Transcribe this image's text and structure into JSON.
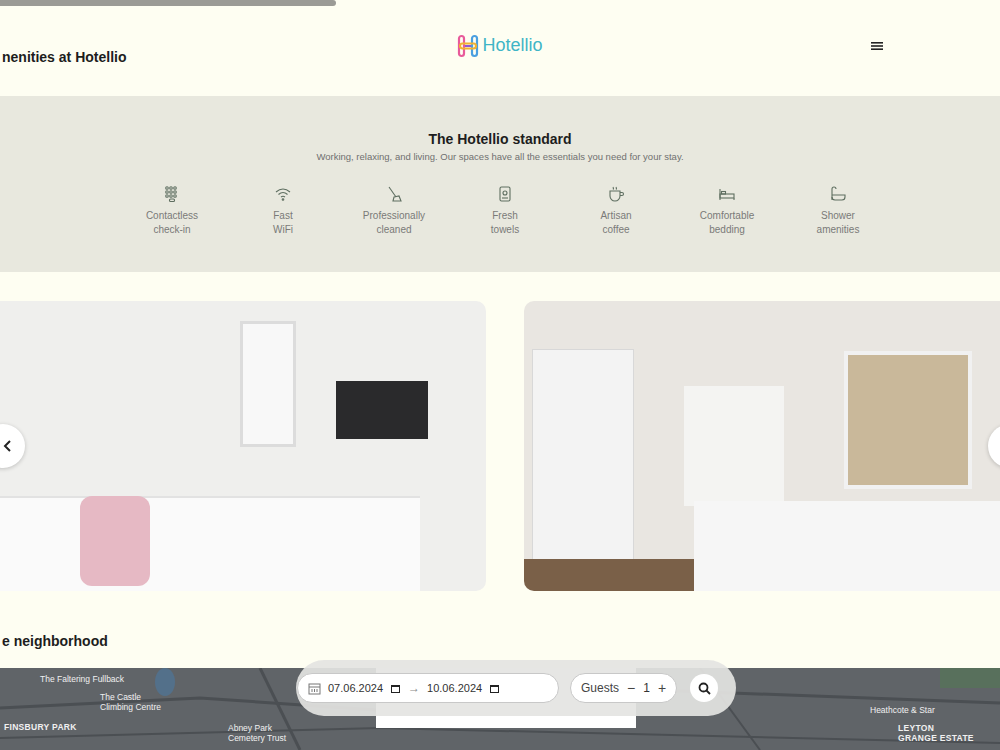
{
  "scroll_progress": {
    "level": 0.336
  },
  "header": {
    "section_title": "nenities at Hotellio",
    "logo": "Hotellio"
  },
  "standard": {
    "title": "The Hotellio standard",
    "subtitle": "Working, relaxing, and living. Our spaces have all the essentials you need for your stay.",
    "amenities": [
      {
        "lines": [
          "Contactless",
          "check-in"
        ]
      },
      {
        "lines": [
          "Fast",
          "WiFi"
        ]
      },
      {
        "lines": [
          "Professionally",
          "cleaned"
        ]
      },
      {
        "lines": [
          "Fresh",
          "towels"
        ]
      },
      {
        "lines": [
          "Artisan",
          "coffee"
        ]
      },
      {
        "lines": [
          "Comfortable",
          "bedding"
        ]
      },
      {
        "lines": [
          "Shower",
          "amenities"
        ]
      }
    ]
  },
  "neighborhood": {
    "title": "e neighborhood",
    "map_labels": [
      {
        "lines": [
          "The Faltering Fullback"
        ]
      },
      {
        "lines": [
          "The Castle",
          "Climbing Centre"
        ]
      },
      {
        "lines": [
          "FINSBURY PARK"
        ]
      },
      {
        "lines": [
          "Abney Park",
          "Cemetery Trust"
        ]
      },
      {
        "lines": [
          "Heathcote & Star"
        ]
      },
      {
        "lines": [
          "LEYTON",
          "GRANGE ESTATE"
        ]
      }
    ]
  },
  "search": {
    "check_in": "07.06.2024",
    "arrow": "→",
    "check_out": "10.06.2024",
    "guests_label": "Guests",
    "minus": "−",
    "count": "1",
    "plus": "+"
  }
}
